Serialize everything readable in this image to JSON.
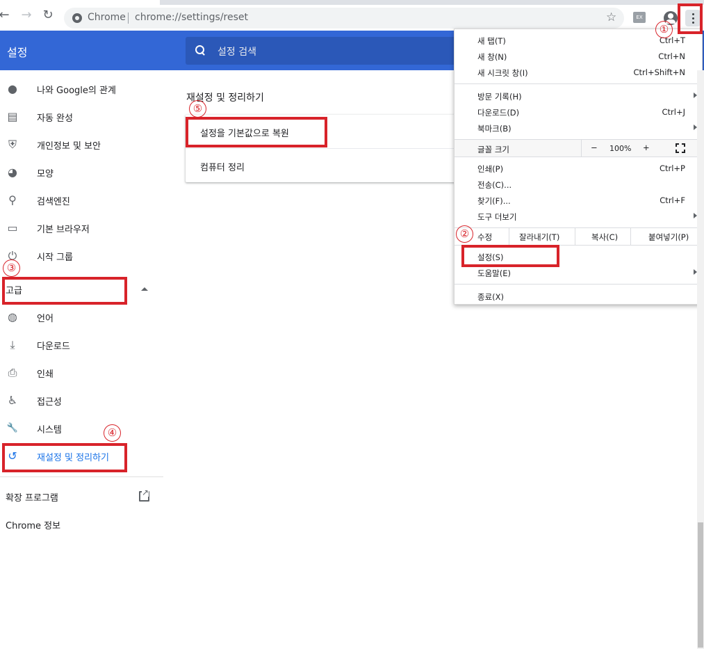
{
  "browser": {
    "back_glyph": "←",
    "forward_glyph": "→",
    "reload_glyph": "↻",
    "url_scheme": "Chrome",
    "url_path": "chrome://settings/reset",
    "star_glyph": "☆",
    "ext_badge": "EX"
  },
  "settings": {
    "header_title": "설정",
    "search_placeholder": "설정 검색"
  },
  "sidebar": {
    "items": [
      {
        "label": "나와 Google의 관계",
        "icon": "person-icon",
        "glyph": "●"
      },
      {
        "label": "자동 완성",
        "icon": "clipboard-icon",
        "glyph": "▤"
      },
      {
        "label": "개인정보 및 보안",
        "icon": "shield-icon",
        "glyph": "⛨"
      },
      {
        "label": "모양",
        "icon": "palette-icon",
        "glyph": "◕"
      },
      {
        "label": "검색엔진",
        "icon": "search-icon",
        "glyph": "⚲"
      },
      {
        "label": "기본 브라우저",
        "icon": "browser-icon",
        "glyph": "▭"
      },
      {
        "label": "시작 그룹",
        "icon": "power-icon",
        "glyph": "⏻"
      }
    ],
    "advanced_label": "고급",
    "advanced_items": [
      {
        "label": "언어",
        "icon": "globe-icon",
        "glyph": "◍"
      },
      {
        "label": "다운로드",
        "icon": "download-icon",
        "glyph": "⤓"
      },
      {
        "label": "인쇄",
        "icon": "printer-icon",
        "glyph": "⎙"
      },
      {
        "label": "접근성",
        "icon": "accessibility-icon",
        "glyph": "♿"
      },
      {
        "label": "시스템",
        "icon": "wrench-icon",
        "glyph": "🔧"
      },
      {
        "label": "재설정 및 정리하기",
        "icon": "restore-icon",
        "glyph": "↺"
      }
    ],
    "extensions_label": "확장 프로그램",
    "about_label": "Chrome 정보"
  },
  "main": {
    "section_title": "재설정 및 정리하기",
    "rows": [
      {
        "label": "설정을 기본값으로 복원"
      },
      {
        "label": "컴퓨터 정리"
      }
    ]
  },
  "menu": {
    "group1": [
      {
        "label": "새 탭(T)",
        "shortcut": "Ctrl+T"
      },
      {
        "label": "새 창(N)",
        "shortcut": "Ctrl+N"
      },
      {
        "label": "새 시크릿 창(I)",
        "shortcut": "Ctrl+Shift+N"
      }
    ],
    "group2": [
      {
        "label": "방문 기록(H)",
        "shortcut": ""
      },
      {
        "label": "다운로드(D)",
        "shortcut": "Ctrl+J"
      },
      {
        "label": "북마크(B)",
        "shortcut": ""
      }
    ],
    "zoom": {
      "label": "글꼴 크기",
      "minus": "−",
      "value": "100%",
      "plus": "+"
    },
    "group3": [
      {
        "label": "인쇄(P)",
        "shortcut": "Ctrl+P"
      },
      {
        "label": "전송(C)...",
        "shortcut": ""
      },
      {
        "label": "찾기(F)...",
        "shortcut": "Ctrl+F"
      },
      {
        "label": "도구 더보기",
        "shortcut": ""
      }
    ],
    "edit": {
      "label": "수정",
      "cut": "잘라내기(T)",
      "copy": "복사(C)",
      "paste": "붙여넣기(P)"
    },
    "group4": [
      {
        "label": "설정(S)",
        "shortcut": ""
      },
      {
        "label": "도움말(E)",
        "shortcut": ""
      }
    ],
    "exit_label": "종료(X)"
  },
  "annotations": {
    "n1": "①",
    "n2": "②",
    "n3": "③",
    "n4": "④",
    "n5": "⑤",
    "color": "#d8232a"
  }
}
